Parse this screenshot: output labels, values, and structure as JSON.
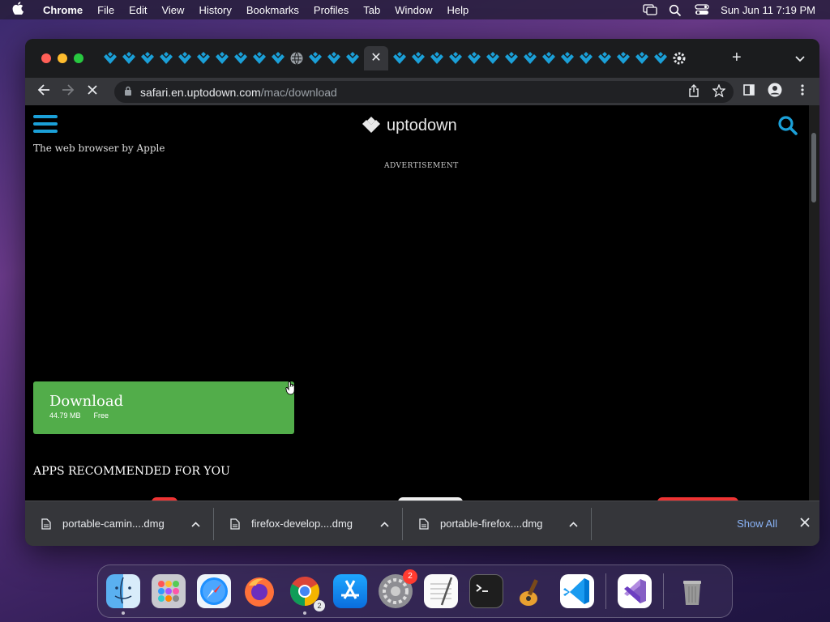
{
  "menubar": {
    "app_name": "Chrome",
    "items": [
      "File",
      "Edit",
      "View",
      "History",
      "Bookmarks",
      "Profiles",
      "Tab",
      "Window",
      "Help"
    ],
    "clock": "Sun Jun 11  7:19 PM"
  },
  "browser": {
    "url_host": "safari.en.uptodown.com",
    "url_path": "/mac/download",
    "tab_icons": [
      "uptodown-favicon",
      "uptodown-favicon",
      "uptodown-favicon",
      "uptodown-favicon",
      "uptodown-favicon",
      "uptodown-favicon",
      "uptodown-favicon",
      "uptodown-favicon",
      "uptodown-favicon",
      "uptodown-favicon",
      "globe-favicon",
      "uptodown-favicon",
      "uptodown-favicon",
      "uptodown-favicon",
      "close-tab",
      "uptodown-favicon",
      "uptodown-favicon",
      "uptodown-favicon",
      "uptodown-favicon",
      "uptodown-favicon",
      "uptodown-favicon",
      "uptodown-favicon",
      "uptodown-favicon",
      "uptodown-favicon",
      "uptodown-favicon",
      "uptodown-favicon",
      "uptodown-favicon",
      "uptodown-favicon",
      "uptodown-favicon",
      "uptodown-favicon",
      "settings-favicon"
    ]
  },
  "page": {
    "logo_text": "uptodown",
    "subtitle": "The web browser by Apple",
    "ad_label": "ADVERTISEMENT",
    "download": {
      "label": "Download",
      "size": "44.79 MB",
      "license": "Free"
    },
    "recommended_heading": "APPS RECOMMENDED FOR YOU"
  },
  "downloads_shelf": {
    "items": [
      {
        "name": "portable-camin....dmg"
      },
      {
        "name": "firefox-develop....dmg"
      },
      {
        "name": "portable-firefox....dmg"
      }
    ],
    "show_all": "Show All"
  },
  "dock": {
    "apps": [
      "finder",
      "launchpad",
      "safari",
      "firefox",
      "chrome",
      "app-store",
      "system-preferences",
      "textedit",
      "terminal",
      "garageband",
      "vscode",
      "visual-studio",
      "trash"
    ],
    "system_preferences_badge": "2",
    "chrome_badge": "2"
  },
  "colors": {
    "accent_blue": "#1ba0d8",
    "download_green": "#52ad4a",
    "link_blue": "#8ab4f8"
  }
}
